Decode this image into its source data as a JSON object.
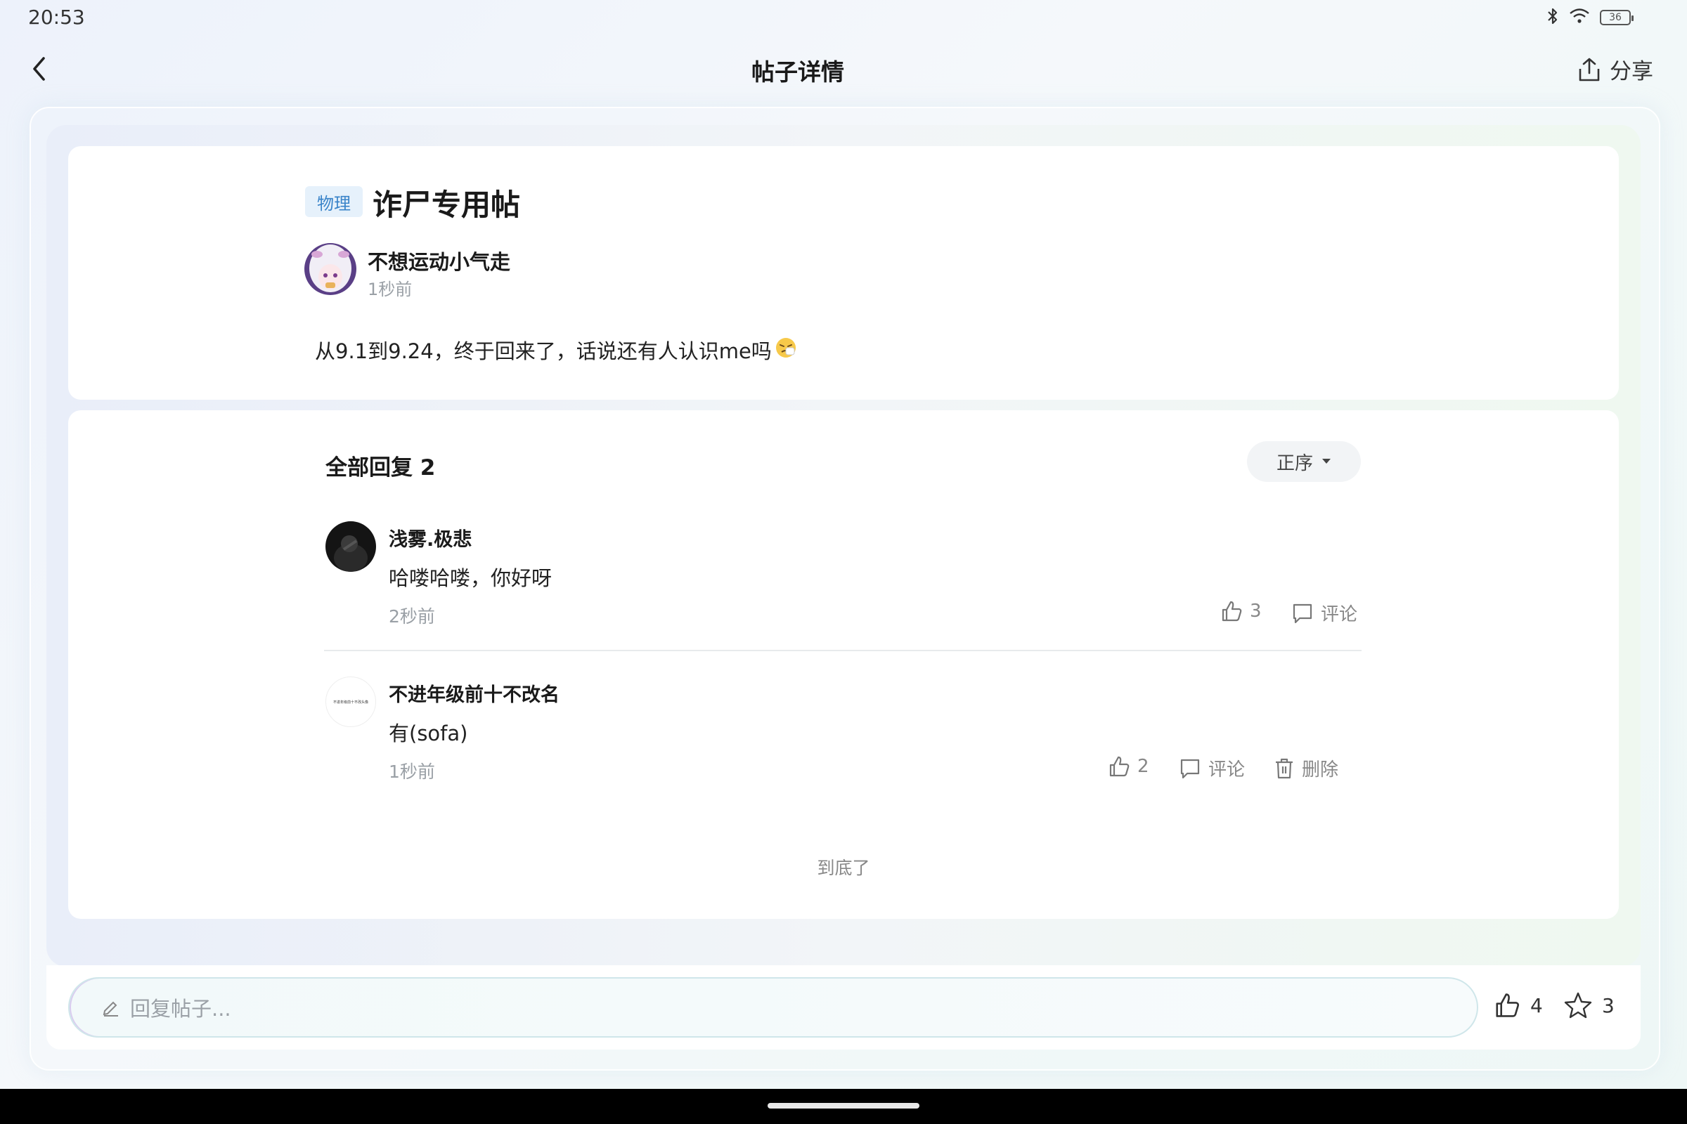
{
  "status_bar": {
    "time": "20:53",
    "battery": "36"
  },
  "header": {
    "title": "帖子详情",
    "share_label": "分享"
  },
  "post": {
    "tag": "物理",
    "title": "诈尸专用帖",
    "author": "不想运动小气走",
    "time": "1秒前",
    "body": "从9.1到9.24，终于回来了，话说还有人认识me吗"
  },
  "replies": {
    "header": "全部回复 2",
    "sort_label": "正序",
    "items": [
      {
        "name": "浅雾.极悲",
        "text": "哈喽哈喽，你好呀",
        "time": "2秒前",
        "likes": "3",
        "comment_label": "评论"
      },
      {
        "name": "不进年级前十不改名",
        "avatar_text": "不进年级前十不改头像",
        "text": "有(sofa)",
        "time": "1秒前",
        "likes": "2",
        "comment_label": "评论",
        "delete_label": "删除"
      }
    ],
    "end_text": "到底了"
  },
  "bottom_bar": {
    "input_placeholder": "回复帖子...",
    "likes": "4",
    "favorites": "3"
  },
  "colors": {
    "tag_bg": "#e6f1fb",
    "tag_text": "#3a84c9",
    "muted": "#9aa0a6"
  }
}
